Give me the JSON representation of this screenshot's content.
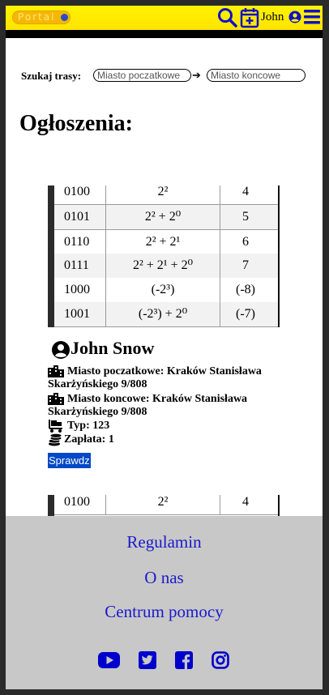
{
  "header": {
    "logo_text": "Portal",
    "user_name": "John"
  },
  "search": {
    "label": "Szukaj trasy:",
    "from_placeholder": "Miasto poczatkowe",
    "to_placeholder": "Miasto koncowe",
    "arrow": "➔"
  },
  "page_title": "Ogłoszenia:",
  "card": {
    "table": [
      [
        "0100",
        "2²",
        "4"
      ],
      [
        "0101",
        "2² + 2⁰",
        "5"
      ],
      [
        "0110",
        "2² + 2¹",
        "6"
      ],
      [
        "0111",
        "2² + 2¹ + 2⁰",
        "7"
      ],
      [
        "1000",
        "(-2³)",
        "(-8)"
      ],
      [
        "1001",
        "(-2³) + 2⁰",
        "(-7)"
      ]
    ],
    "author": "John Snow",
    "start_label": "Miasto poczatkowe: Kraków Stanisława Skarżyńskiego 9/808",
    "end_label": "Miasto koncowe: Kraków Stanisława Skarżyńskiego 9/808",
    "type_label": "Typ: 123",
    "payment_label": "Zapłata: 1",
    "check_button": "Sprawdz"
  },
  "card2_table_first_row": [
    "0100",
    "2²",
    "4"
  ],
  "footer": {
    "links": [
      "Regulamin",
      "O nas",
      "Centrum pomocy"
    ],
    "social_icons": [
      "youtube-icon",
      "twitter-icon",
      "facebook-icon",
      "instagram-icon"
    ],
    "link_color": "#1a1acc",
    "icon_color": "#0000cc"
  },
  "colors": {
    "header_bg": "#fff200",
    "button_bg": "#0048c8",
    "footer_bg": "#c8c8c8",
    "icon_blue": "#1010cc"
  }
}
